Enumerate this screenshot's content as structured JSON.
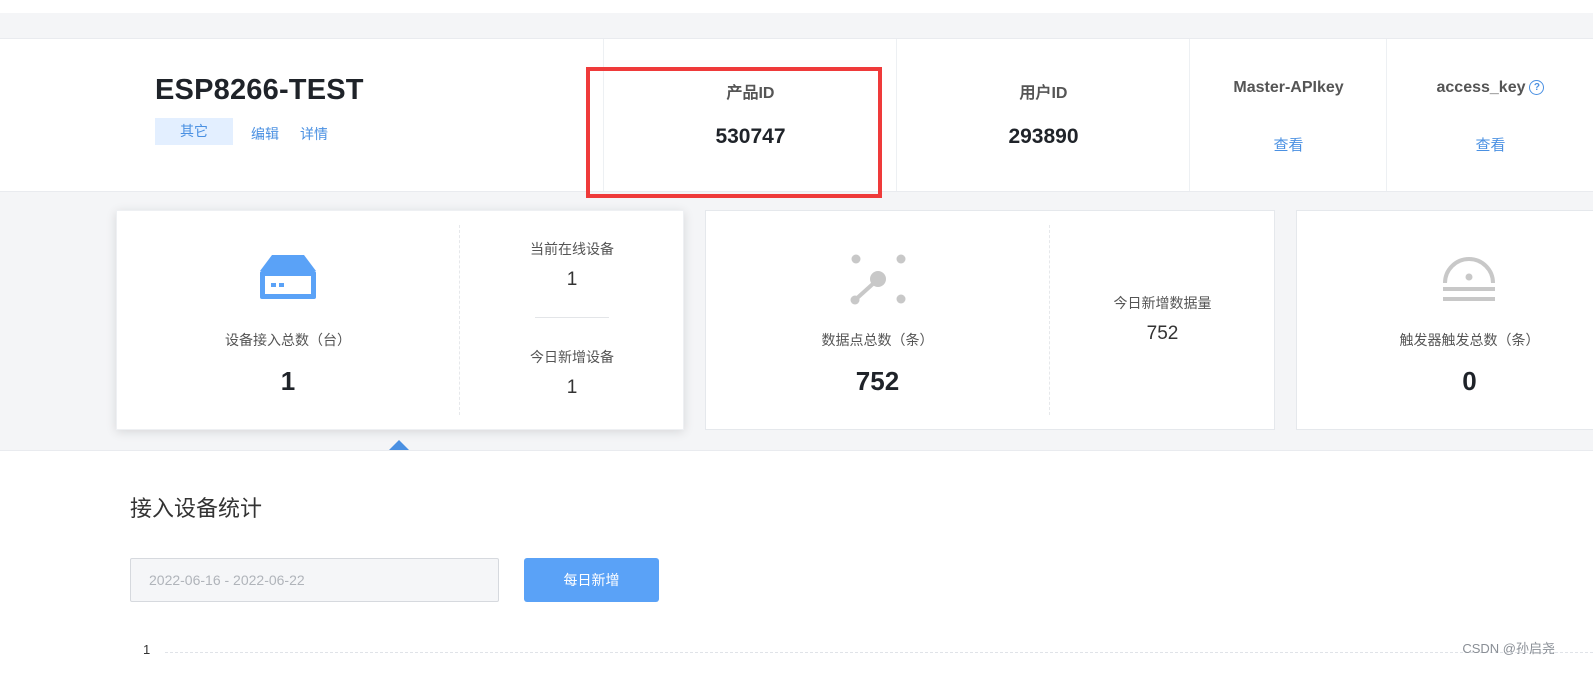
{
  "product": {
    "name": "ESP8266-TEST",
    "tag": "其它",
    "edit_link": "编辑",
    "detail_link": "详情"
  },
  "header_cols": {
    "product_id": {
      "label": "产品ID",
      "value": "530747"
    },
    "user_id": {
      "label": "用户ID",
      "value": "293890"
    },
    "master_apikey": {
      "label": "Master-APIkey",
      "link": "查看"
    },
    "access_key": {
      "label": "access_key",
      "link": "查看",
      "help": "?"
    }
  },
  "stats": {
    "devices": {
      "total_label": "设备接入总数（台）",
      "total_value": "1",
      "online_label": "当前在线设备",
      "online_value": "1",
      "new_label": "今日新增设备",
      "new_value": "1",
      "icon": "server-icon"
    },
    "datapoints": {
      "total_label": "数据点总数（条）",
      "total_value": "752",
      "new_label": "今日新增数据量",
      "new_value": "752",
      "icon": "datapoint-icon"
    },
    "triggers": {
      "total_label": "触发器触发总数（条）",
      "total_value": "0",
      "icon": "trigger-icon"
    }
  },
  "section": {
    "title": "接入设备统计",
    "date_range": "2022-06-16 - 2022-06-22",
    "daily_button": "每日新增",
    "y_tick": "1"
  },
  "watermark": "CSDN @孙启尧",
  "colors": {
    "accent": "#4a90e2",
    "highlight_box": "#ef3a3a",
    "button": "#5aa2f7"
  }
}
